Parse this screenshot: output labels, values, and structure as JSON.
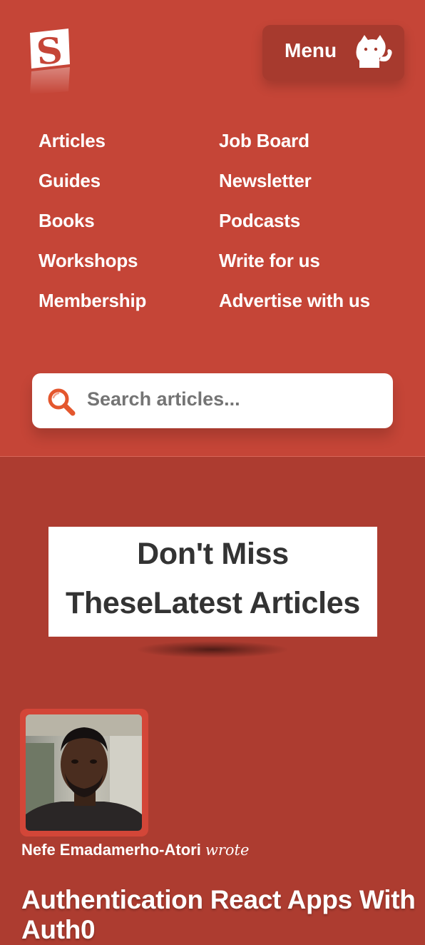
{
  "header": {
    "menu_label": "Menu"
  },
  "nav": {
    "items": [
      "Articles",
      "Guides",
      "Books",
      "Workshops",
      "Membership",
      "Job Board",
      "Newsletter",
      "Podcasts",
      "Write for us",
      "Advertise with us"
    ]
  },
  "search": {
    "placeholder": "Search articles..."
  },
  "headline": {
    "line1": "Don't Miss",
    "line2": "TheseLatest Articles"
  },
  "article": {
    "author": "Nefe Emadamerho-Atori",
    "verb": "wrote",
    "title": "Authentication React Apps With Auth0"
  },
  "colors": {
    "header_bg": "#c54537",
    "page_bg": "#ad3c30",
    "menu_button_bg": "#a73a2e",
    "search_icon": "#e4572e"
  },
  "icons": {
    "logo": "smashing-logo",
    "menu": "cat-icon",
    "search": "search-icon"
  }
}
